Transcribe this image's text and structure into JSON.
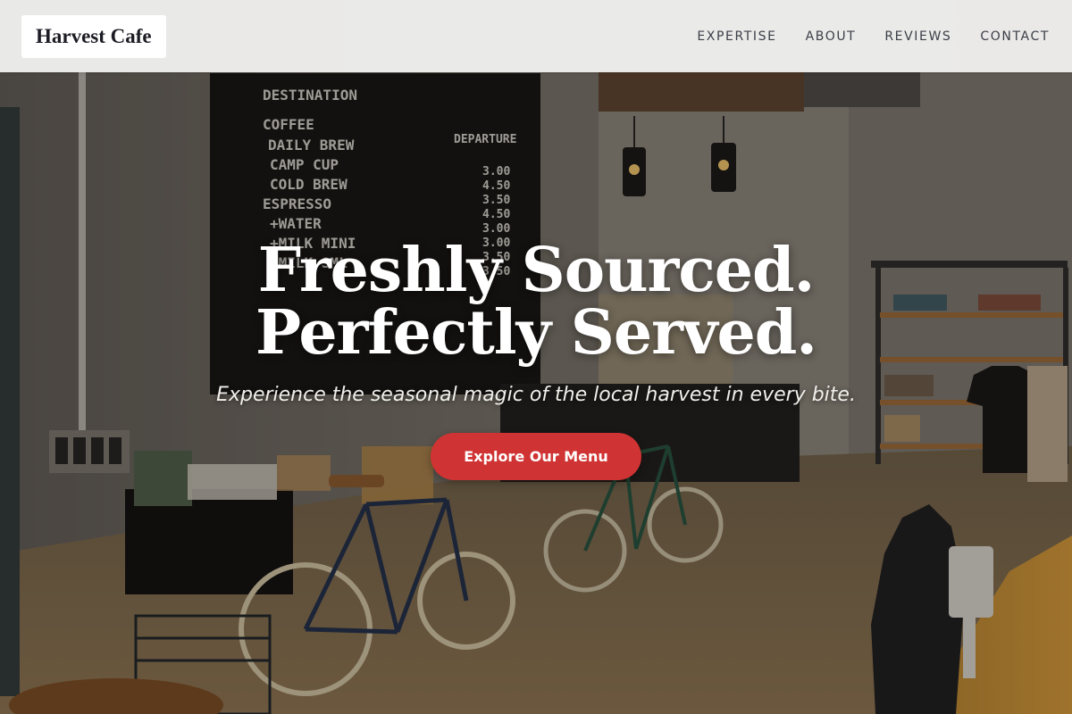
{
  "header": {
    "logo": "Harvest Cafe",
    "nav": [
      {
        "label": "EXPERTISE"
      },
      {
        "label": "ABOUT"
      },
      {
        "label": "REVIEWS"
      },
      {
        "label": "CONTACT"
      }
    ]
  },
  "hero": {
    "headline_line1": "Freshly Sourced.",
    "headline_line2": "Perfectly Served.",
    "subheadline": "Experience the seasonal magic of the local harvest in every bite.",
    "cta_label": "Explore Our Menu",
    "menu_board": {
      "title": "DESTINATION",
      "column_right": "DEPARTURE",
      "items": [
        "COFFEE",
        "DAILY BREW",
        "CAMP CUP",
        "COLD BREW",
        "ESPRESSO",
        "+WATER",
        "+MILK MINI",
        "+MILK SML"
      ],
      "prices": [
        "3.00",
        "4.50",
        "3.50",
        "4.50",
        "3.00",
        "3.00",
        "3.50",
        "3.50"
      ]
    }
  },
  "colors": {
    "accent": "#d03333",
    "header_bg": "#f5f5f4",
    "text_dark": "#1c1c24"
  }
}
